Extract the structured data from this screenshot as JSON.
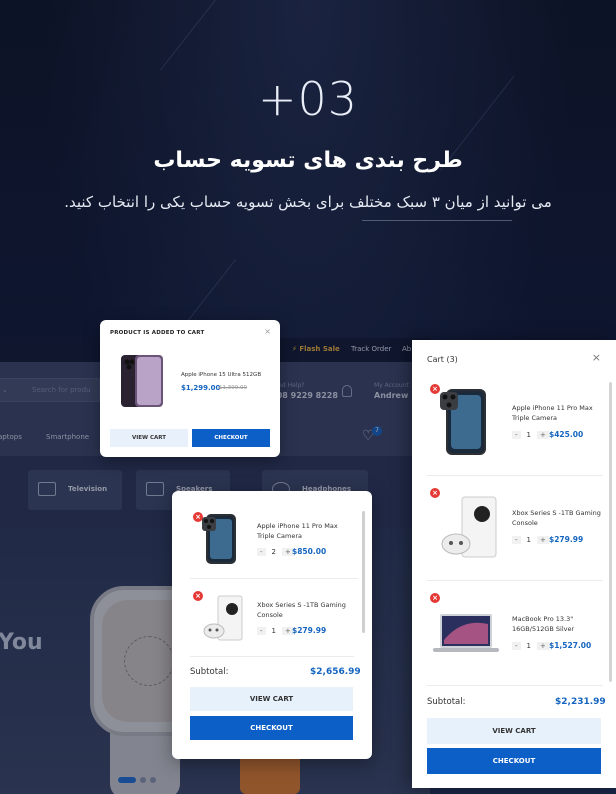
{
  "hero": {
    "number": "+03",
    "title": "طرح بندی های تسویه حساب",
    "subtitle": "می توانید از میان ۳ سبک مختلف برای بخش تسویه حساب یکی را انتخاب کنید."
  },
  "store": {
    "nav": {
      "flash_sale": "⚡ Flash Sale",
      "track_order": "Track Order",
      "about": "Ab"
    },
    "search_placeholder": "Search for produ",
    "help": {
      "label": "Need Help?",
      "phone": "+08 9229 8228"
    },
    "account": {
      "label": "My Account",
      "name": "Andrew"
    },
    "categories": [
      "aptops",
      "Smartphone"
    ],
    "wishlist_count": "7",
    "tiles": [
      "Television",
      "Speakers",
      "Headphones"
    ],
    "hero_text": "You"
  },
  "popup_added": {
    "header": "PRODUCT IS ADDED TO CART",
    "close": "×",
    "product": "Apple iPhone 15 Ultra 512GB",
    "price": "$1,299.00",
    "old_price": "$1,399.00",
    "view_cart": "VIEW CART",
    "checkout": "CHECKOUT"
  },
  "cart_mini": {
    "items": [
      {
        "name": "Apple iPhone 11 Pro Max Triple Camera",
        "qty": "2",
        "price": "$850.00"
      },
      {
        "name": "Xbox Series S -1TB Gaming Console",
        "qty": "1",
        "price": "$279.99"
      }
    ],
    "subtotal_label": "Subtotal:",
    "subtotal": "$2,656.99",
    "view_cart": "VIEW CART",
    "checkout": "CHECKOUT"
  },
  "cart_panel": {
    "title": "Cart (3)",
    "close": "×",
    "items": [
      {
        "name": "Apple iPhone 11 Pro Max Triple Camera",
        "qty": "1",
        "price": "$425.00"
      },
      {
        "name": "Xbox Series S -1TB Gaming Console",
        "qty": "1",
        "price": "$279.99"
      },
      {
        "name": "MacBook Pro 13.3\" 16GB/512GB Silver",
        "qty": "1",
        "price": "$1,527.00"
      }
    ],
    "subtotal_label": "Subtotal:",
    "subtotal": "$2,231.99",
    "view_cart": "VIEW CART",
    "checkout": "CHECKOUT"
  },
  "colors": {
    "accent": "#0d5fc8",
    "price": "#1565c0",
    "remove": "#e53935",
    "background": "#0d1326"
  }
}
